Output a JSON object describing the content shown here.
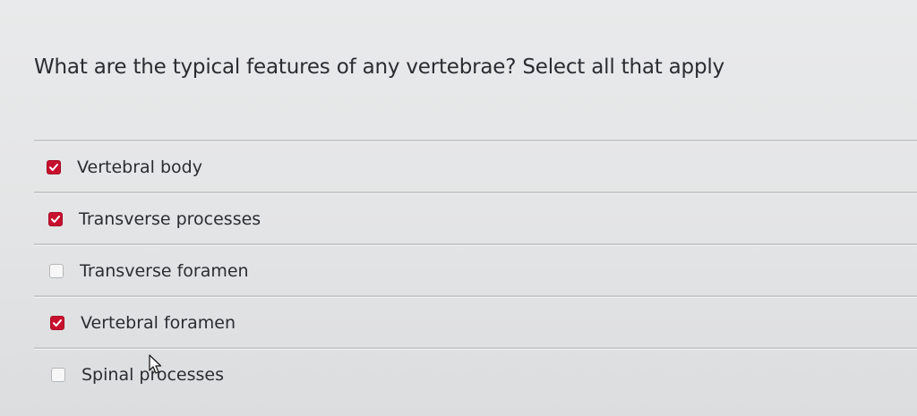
{
  "question": {
    "text": "What are the typical features of any vertebrae? Select all that apply"
  },
  "options": [
    {
      "label": "Vertebral body",
      "checked": true
    },
    {
      "label": "Transverse processes",
      "checked": true
    },
    {
      "label": "Transverse foramen",
      "checked": false
    },
    {
      "label": "Vertebral foramen",
      "checked": true
    },
    {
      "label": "Spinal processes",
      "checked": false
    }
  ],
  "colors": {
    "checkbox_checked": "#c8102e",
    "checkbox_unchecked": "#f7f7f7",
    "text": "#2a2c31"
  },
  "icons": {
    "check": "checkmark-icon",
    "cursor": "mouse-pointer-icon"
  }
}
